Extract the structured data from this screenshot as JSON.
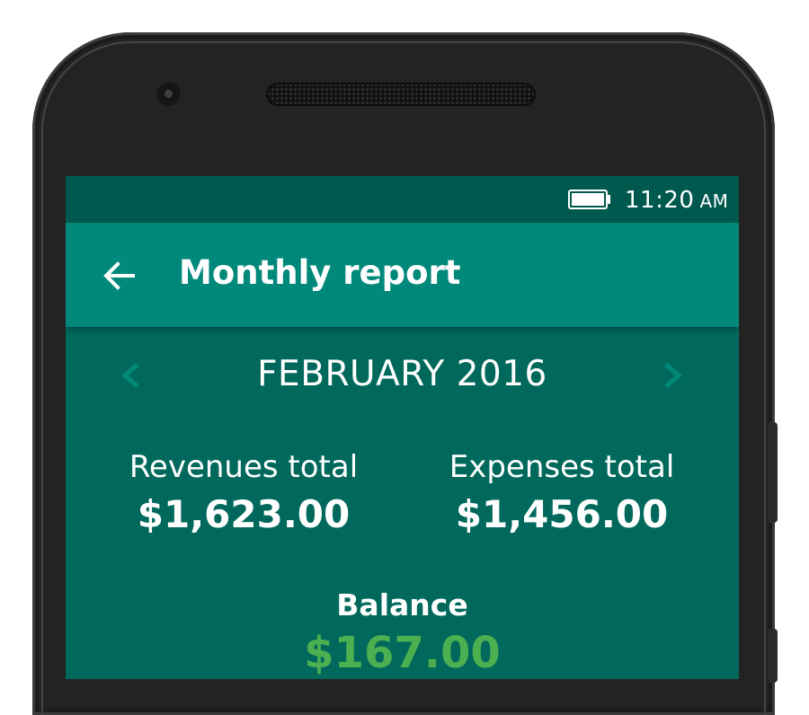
{
  "status_bar": {
    "time": "11:20",
    "ampm": "AM",
    "battery_icon": "battery-full-icon"
  },
  "app_bar": {
    "back_icon": "arrow-back-icon",
    "title": "Monthly report"
  },
  "month_nav": {
    "prev_icon": "chevron-left-icon",
    "next_icon": "chevron-right-icon",
    "label": "FEBRUARY 2016"
  },
  "summary": {
    "revenues_label": "Revenues total",
    "revenues_value": "$1,623.00",
    "expenses_label": "Expenses total",
    "expenses_value": "$1,456.00",
    "balance_label": "Balance",
    "balance_value": "$167.00"
  },
  "colors": {
    "screen_bg": "#00695c",
    "status_bar": "#00594e",
    "app_bar": "#00897b",
    "nav_arrow": "#00897b",
    "balance_positive": "#4caf50",
    "text": "#ffffff"
  }
}
